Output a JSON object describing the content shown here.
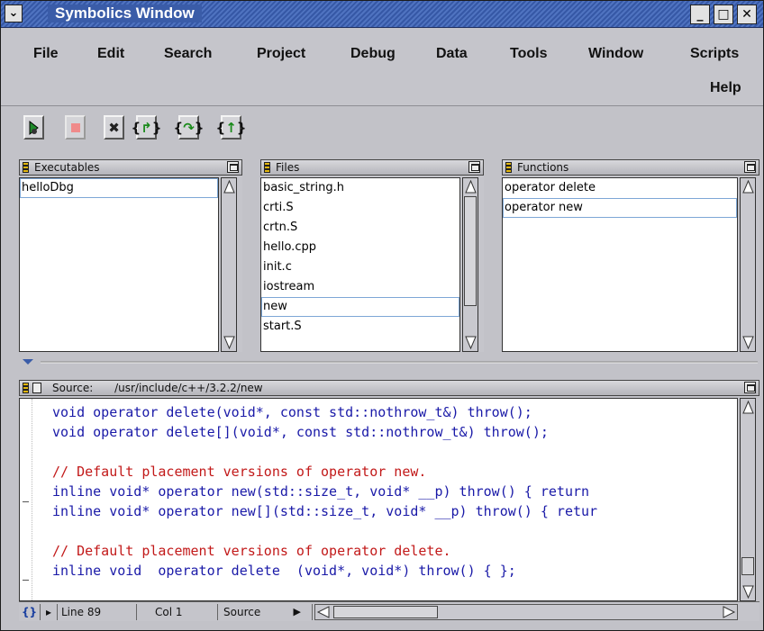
{
  "window": {
    "title": "Symbolics Window",
    "accent": "#3a5ca8"
  },
  "menu": [
    "File",
    "Edit",
    "Search",
    "Project",
    "Debug",
    "Data",
    "Tools",
    "Window",
    "Scripts",
    "Help"
  ],
  "toolbar": {
    "buttons": [
      {
        "name": "run-debug-icon"
      },
      {
        "name": "stop-icon"
      },
      {
        "name": "kill-icon"
      },
      {
        "name": "step-into-icon"
      },
      {
        "name": "step-over-icon"
      },
      {
        "name": "step-out-icon"
      }
    ]
  },
  "panes": {
    "executables": {
      "title": "Executables",
      "items": [
        "helloDbg"
      ],
      "selected": 0
    },
    "files": {
      "title": "Files",
      "items": [
        "basic_string.h",
        "crti.S",
        "crtn.S",
        "hello.cpp",
        "init.c",
        "iostream",
        "new",
        "start.S"
      ],
      "selected": 6
    },
    "functions": {
      "title": "Functions",
      "items": [
        "operator delete",
        "operator new"
      ],
      "selected": 1
    }
  },
  "source": {
    "label": "Source:",
    "path": "/usr/include/c++/3.2.2/new",
    "lines": [
      {
        "text": "void operator delete(void*, const std::nothrow_t&) throw();",
        "type": "code"
      },
      {
        "text": "void operator delete[](void*, const std::nothrow_t&) throw();",
        "type": "code"
      },
      {
        "text": "",
        "type": "blank"
      },
      {
        "text": "// Default placement versions of operator new.",
        "type": "comment"
      },
      {
        "text": "inline void* operator new(std::size_t, void* __p) throw() { return",
        "type": "code"
      },
      {
        "text": "inline void* operator new[](std::size_t, void* __p) throw() { retur",
        "type": "code"
      },
      {
        "text": "",
        "type": "blank"
      },
      {
        "text": "// Default placement versions of operator delete.",
        "type": "comment"
      },
      {
        "text": "inline void  operator delete  (void*, void*) throw() { };",
        "type": "code"
      }
    ]
  },
  "status": {
    "brace": "{}",
    "line": "Line 89",
    "col": "Col 1",
    "view": "Source"
  }
}
